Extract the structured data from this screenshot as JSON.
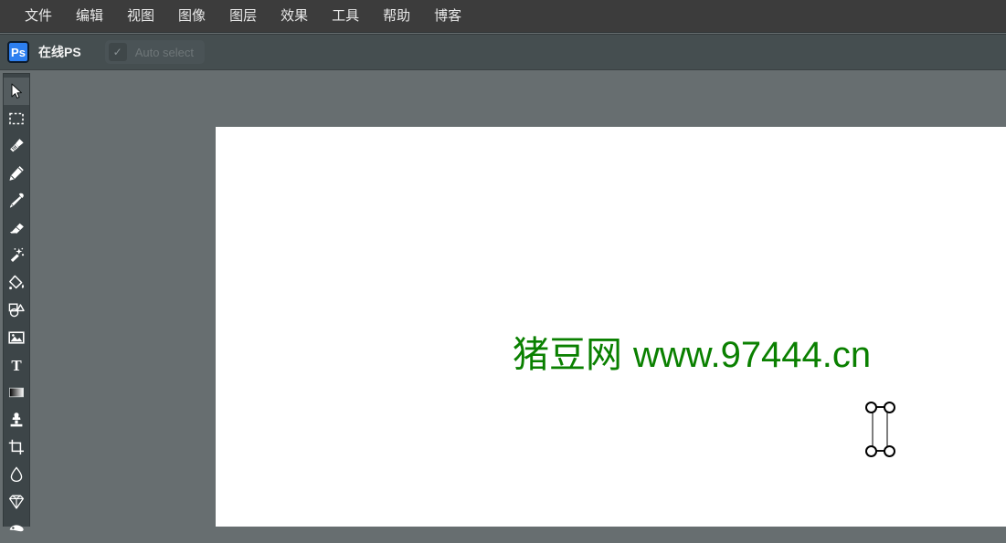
{
  "menubar": {
    "items": [
      {
        "label": "文件",
        "name": "menu-file"
      },
      {
        "label": "编辑",
        "name": "menu-edit"
      },
      {
        "label": "视图",
        "name": "menu-view"
      },
      {
        "label": "图像",
        "name": "menu-image"
      },
      {
        "label": "图层",
        "name": "menu-layer"
      },
      {
        "label": "效果",
        "name": "menu-effects"
      },
      {
        "label": "工具",
        "name": "menu-tools"
      },
      {
        "label": "帮助",
        "name": "menu-help"
      },
      {
        "label": "博客",
        "name": "menu-blog"
      }
    ]
  },
  "optionsbar": {
    "logo_text": "Ps",
    "brand_label": "在线PS",
    "auto_select": {
      "label": "Auto select",
      "checked_glyph": "✓",
      "checked": true,
      "enabled": false
    }
  },
  "toolpanel": {
    "active_index": 0,
    "tools": [
      {
        "name": "move-tool-icon",
        "label": "移动工具"
      },
      {
        "name": "marquee-select-tool-icon",
        "label": "选框工具"
      },
      {
        "name": "brush-tool-icon",
        "label": "画笔工具"
      },
      {
        "name": "pencil-tool-icon",
        "label": "铅笔工具"
      },
      {
        "name": "eyedropper-tool-icon",
        "label": "吸管工具"
      },
      {
        "name": "eraser-tool-icon",
        "label": "橡皮擦工具"
      },
      {
        "name": "magic-wand-tool-icon",
        "label": "魔棒工具"
      },
      {
        "name": "paint-bucket-tool-icon",
        "label": "油漆桶工具"
      },
      {
        "name": "shape-tool-icon",
        "label": "形状工具"
      },
      {
        "name": "image-tool-icon",
        "label": "图像工具"
      },
      {
        "name": "text-tool-icon",
        "label": "文字工具"
      },
      {
        "name": "gradient-tool-icon",
        "label": "渐变工具"
      },
      {
        "name": "clone-stamp-tool-icon",
        "label": "仿制图章工具"
      },
      {
        "name": "crop-tool-icon",
        "label": "裁剪工具"
      },
      {
        "name": "blur-tool-icon",
        "label": "模糊工具"
      },
      {
        "name": "sharpen-tool-icon",
        "label": "锐化工具"
      },
      {
        "name": "smudge-tool-icon",
        "label": "涂抹工具"
      }
    ]
  },
  "canvas": {
    "watermark_cjk": "猪豆网",
    "watermark_latin": "www.97444.cn",
    "watermark_color": "#0a8000"
  },
  "colors": {
    "menubar_bg": "#3c3c3c",
    "optionsbar_bg": "#454e50",
    "toolpanel_bg": "#3d4548",
    "workspace_bg": "#676e70",
    "canvas_bg": "#ffffff",
    "accent_blue": "#2d7ff0",
    "watermark_green": "#0a8000"
  }
}
